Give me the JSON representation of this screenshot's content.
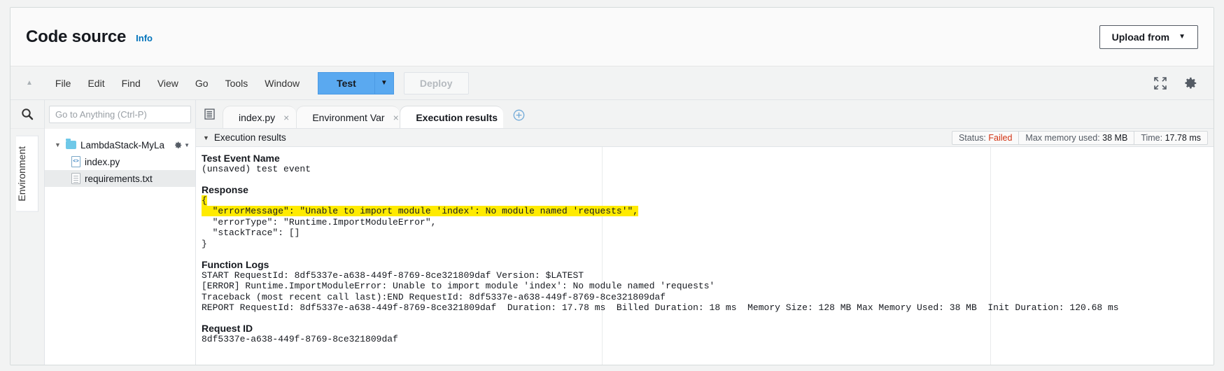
{
  "header": {
    "title": "Code source",
    "info_link": "Info",
    "upload_button": "Upload from",
    "upload_caret": "▼"
  },
  "menubar": {
    "collapse_icon": "▲",
    "items": [
      "File",
      "Edit",
      "Find",
      "View",
      "Go",
      "Tools",
      "Window"
    ],
    "test_button": "Test",
    "test_caret": "▼",
    "deploy_button": "Deploy",
    "fullscreen_icon": "expand-icon",
    "settings_icon": "gear-icon"
  },
  "rail": {
    "search_icon": "search-icon",
    "environment_tab": "Environment"
  },
  "explorer": {
    "goto_placeholder": "Go to Anything (Ctrl-P)",
    "goto_value": "",
    "tree": [
      {
        "label": "LambdaStack-MyLa",
        "type": "folder",
        "twisty": "▼",
        "selected": false,
        "gear": true
      },
      {
        "label": "index.py",
        "type": "code",
        "selected": false
      },
      {
        "label": "requirements.txt",
        "type": "txt",
        "selected": true
      }
    ]
  },
  "tabs": {
    "list_icon": "tab-list-icon",
    "add_icon": "⊕",
    "items": [
      {
        "label": "index.py",
        "active": false,
        "close": "×"
      },
      {
        "label": "Environment Var",
        "active": false,
        "close": "×"
      },
      {
        "label": "Execution results",
        "active": true,
        "close": "×"
      }
    ]
  },
  "results": {
    "panel_label": "Execution results",
    "twisty": "▼",
    "badges": [
      {
        "label": "Status: ",
        "value": "Failed",
        "state": "failed"
      },
      {
        "label": "Max memory used: ",
        "value": "38 MB",
        "state": "normal"
      },
      {
        "label": "Time: ",
        "value": "17.78 ms",
        "state": "normal"
      }
    ],
    "test_event_name_title": "Test Event Name",
    "test_event_name_value": "(unsaved) test event",
    "response_title": "Response",
    "response_open_brace": "{",
    "response_error_message": "  \"errorMessage\": \"Unable to import module 'index': No module named 'requests'\",",
    "response_error_type": "  \"errorType\": \"Runtime.ImportModuleError\",",
    "response_stack_trace": "  \"stackTrace\": []",
    "response_close_brace": "}",
    "function_logs_title": "Function Logs",
    "log_lines": [
      "START RequestId: 8df5337e-a638-449f-8769-8ce321809daf Version: $LATEST",
      "[ERROR] Runtime.ImportModuleError: Unable to import module 'index': No module named 'requests'",
      "Traceback (most recent call last):END RequestId: 8df5337e-a638-449f-8769-8ce321809daf",
      "REPORT RequestId: 8df5337e-a638-449f-8769-8ce321809daf  Duration: 17.78 ms  Billed Duration: 18 ms  Memory Size: 128 MB Max Memory Used: 38 MB  Init Duration: 120.68 ms"
    ],
    "request_id_title": "Request ID",
    "request_id_value": "8df5337e-a638-449f-8769-8ce321809daf"
  },
  "colors": {
    "accent_blue": "#0073bb",
    "test_blue": "#5aa9f0",
    "highlight_yellow": "#ffeb00",
    "failed_red": "#d13212"
  }
}
